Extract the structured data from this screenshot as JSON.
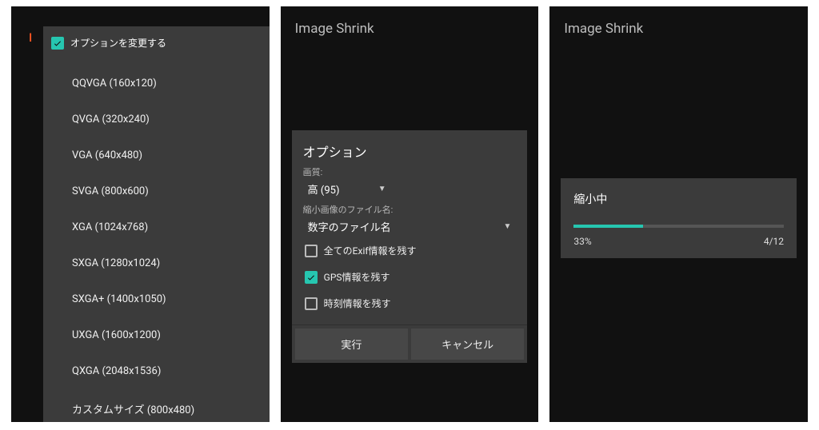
{
  "accent": "#26c6b0",
  "screen1": {
    "back_text": "I",
    "header_label": "オプションを変更する",
    "items": [
      "QQVGA (160x120)",
      "QVGA (320x240)",
      "VGA (640x480)",
      "SVGA (800x600)",
      "XGA (1024x768)",
      "SXGA (1280x1024)",
      "SXGA+ (1400x1050)",
      "UXGA (1600x1200)",
      "QXGA (2048x1536)",
      "カスタムサイズ (800x480)"
    ]
  },
  "screen2": {
    "title": "Image Shrink",
    "dialog_title": "オプション",
    "quality_label": "画質:",
    "quality_value": "高 (95)",
    "filename_label": "縮小画像のファイル名:",
    "filename_value": "数字のファイル名",
    "chk_exif": "全てのExif情報を残す",
    "chk_gps": "GPS情報を残す",
    "chk_time": "時刻情報を残す",
    "run": "実行",
    "cancel": "キャンセル"
  },
  "screen3": {
    "title": "Image Shrink",
    "progress_title": "縮小中",
    "percent_text": "33%",
    "count_text": "4/12",
    "percent_width": "33%"
  }
}
